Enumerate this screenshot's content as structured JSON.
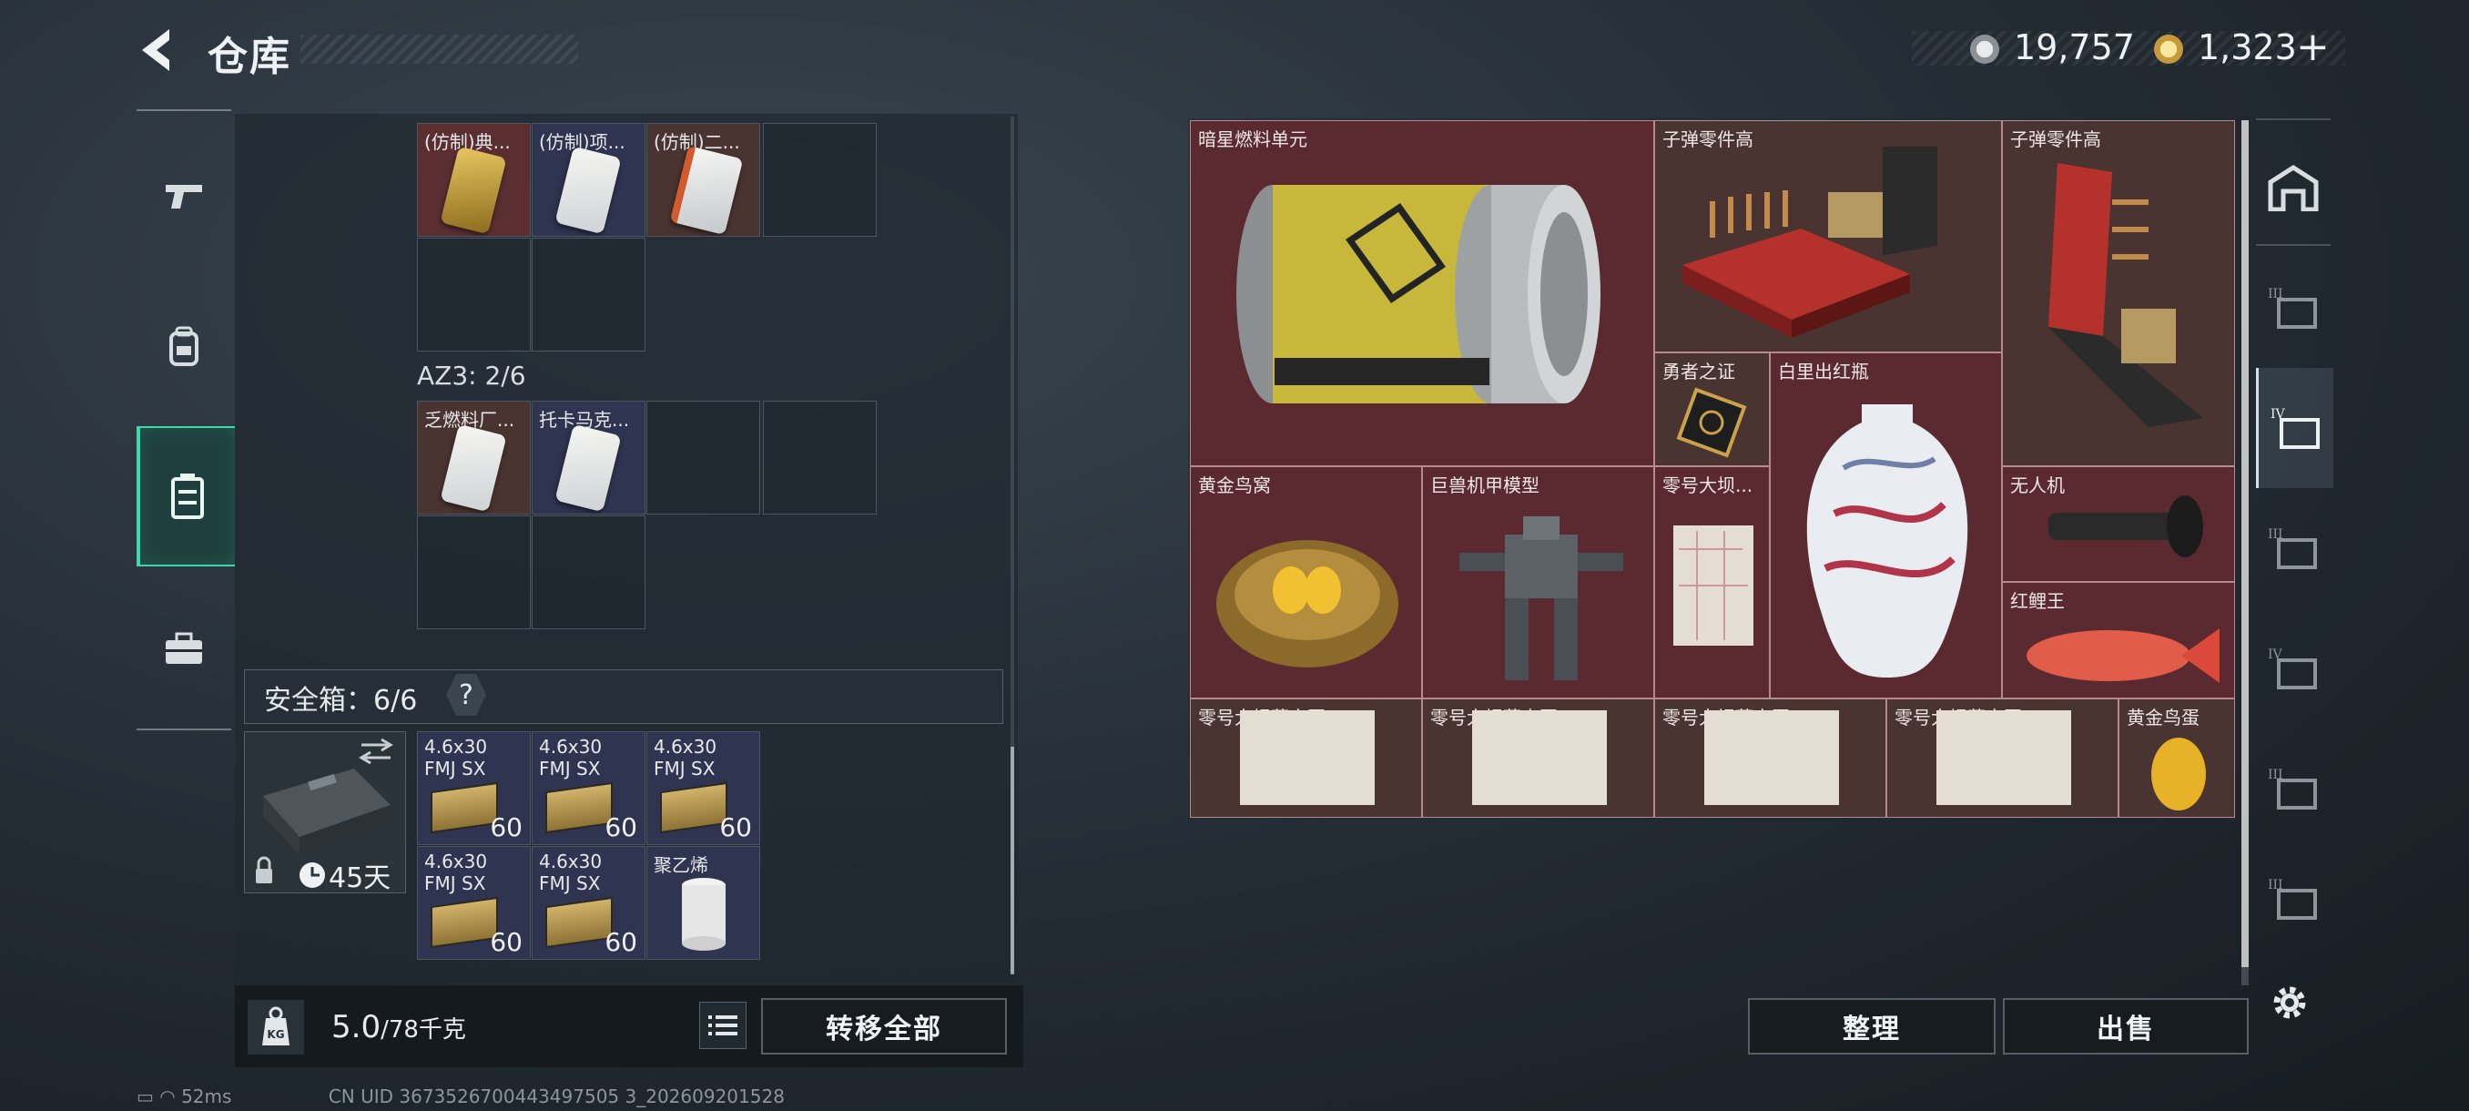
{
  "header": {
    "title": "仓库",
    "back_icon": "back-chevron-icon"
  },
  "currency": {
    "silver": "19,757",
    "gold": "1,323",
    "add_label": "+"
  },
  "left_tabs": [
    {
      "icon": "gun-icon"
    },
    {
      "icon": "backpack-icon"
    },
    {
      "icon": "container-icon",
      "active": true
    },
    {
      "icon": "briefcase-icon"
    }
  ],
  "left_storage": {
    "row1": [
      {
        "label": "(仿制)典..."
      },
      {
        "label": "(仿制)项..."
      },
      {
        "label": "(仿制)二..."
      }
    ],
    "az3_label": "AZ3: 2/6",
    "row2": [
      {
        "label": "乏燃料厂..."
      },
      {
        "label": "托卡马克..."
      }
    ],
    "safebox_title": "安全箱：6/6",
    "help": "?",
    "safebox_timer": "45天",
    "safebox_items": [
      {
        "label": "4.6x30",
        "label2": "FMJ SX",
        "qty": "60"
      },
      {
        "label": "4.6x30",
        "label2": "FMJ SX",
        "qty": "60"
      },
      {
        "label": "4.6x30",
        "label2": "FMJ SX",
        "qty": "60"
      },
      {
        "label": "4.6x30",
        "label2": "FMJ SX",
        "qty": "60"
      },
      {
        "label": "4.6x30",
        "label2": "FMJ SX",
        "qty": "60"
      },
      {
        "label": "聚乙烯",
        "label2": "",
        "qty": ""
      }
    ]
  },
  "bottom": {
    "weight": "5.0",
    "weight_max": "/78千克",
    "transfer_all": "转移全部"
  },
  "right_items": {
    "dark_fuel": "暗星燃料单元",
    "ammo_parts_1": "子弹零件高",
    "ammo_parts_2": "子弹零件高",
    "hero_proof": "勇者之证",
    "vase": "白里出红瓶",
    "gold_nest": "黄金鸟窝",
    "mech_model": "巨兽机甲模型",
    "dam_map_top": "零号大坝...",
    "drone": "无人机",
    "carp": "红鲤王",
    "map1": "零号大坝藏宝图-5",
    "map2": "零号大坝藏宝图-4",
    "map3": "零号大坝藏宝图-4",
    "map4": "零号大坝藏宝图-4",
    "gold_egg": "黄金鸟蛋"
  },
  "right_actions": {
    "sort": "整理",
    "sell": "出售"
  },
  "right_tabs": [
    {
      "icon": "warehouse-icon"
    },
    {
      "icon": "storage-tier-icon",
      "tier": "III"
    },
    {
      "icon": "storage-tier-icon",
      "tier": "IV",
      "active": true
    },
    {
      "icon": "storage-tier-icon",
      "tier": "III"
    },
    {
      "icon": "storage-tier-icon",
      "tier": "IV"
    },
    {
      "icon": "storage-tier-icon",
      "tier": "III"
    },
    {
      "icon": "storage-tier-icon",
      "tier": "III"
    }
  ],
  "status_bar": {
    "ping": "52ms",
    "uid": "CN UID 3673526700443497505 3_202609201528"
  },
  "colors": {
    "accent": "#3fd8a8",
    "item_red": "#5a2a30",
    "item_brown": "#4a3431"
  }
}
